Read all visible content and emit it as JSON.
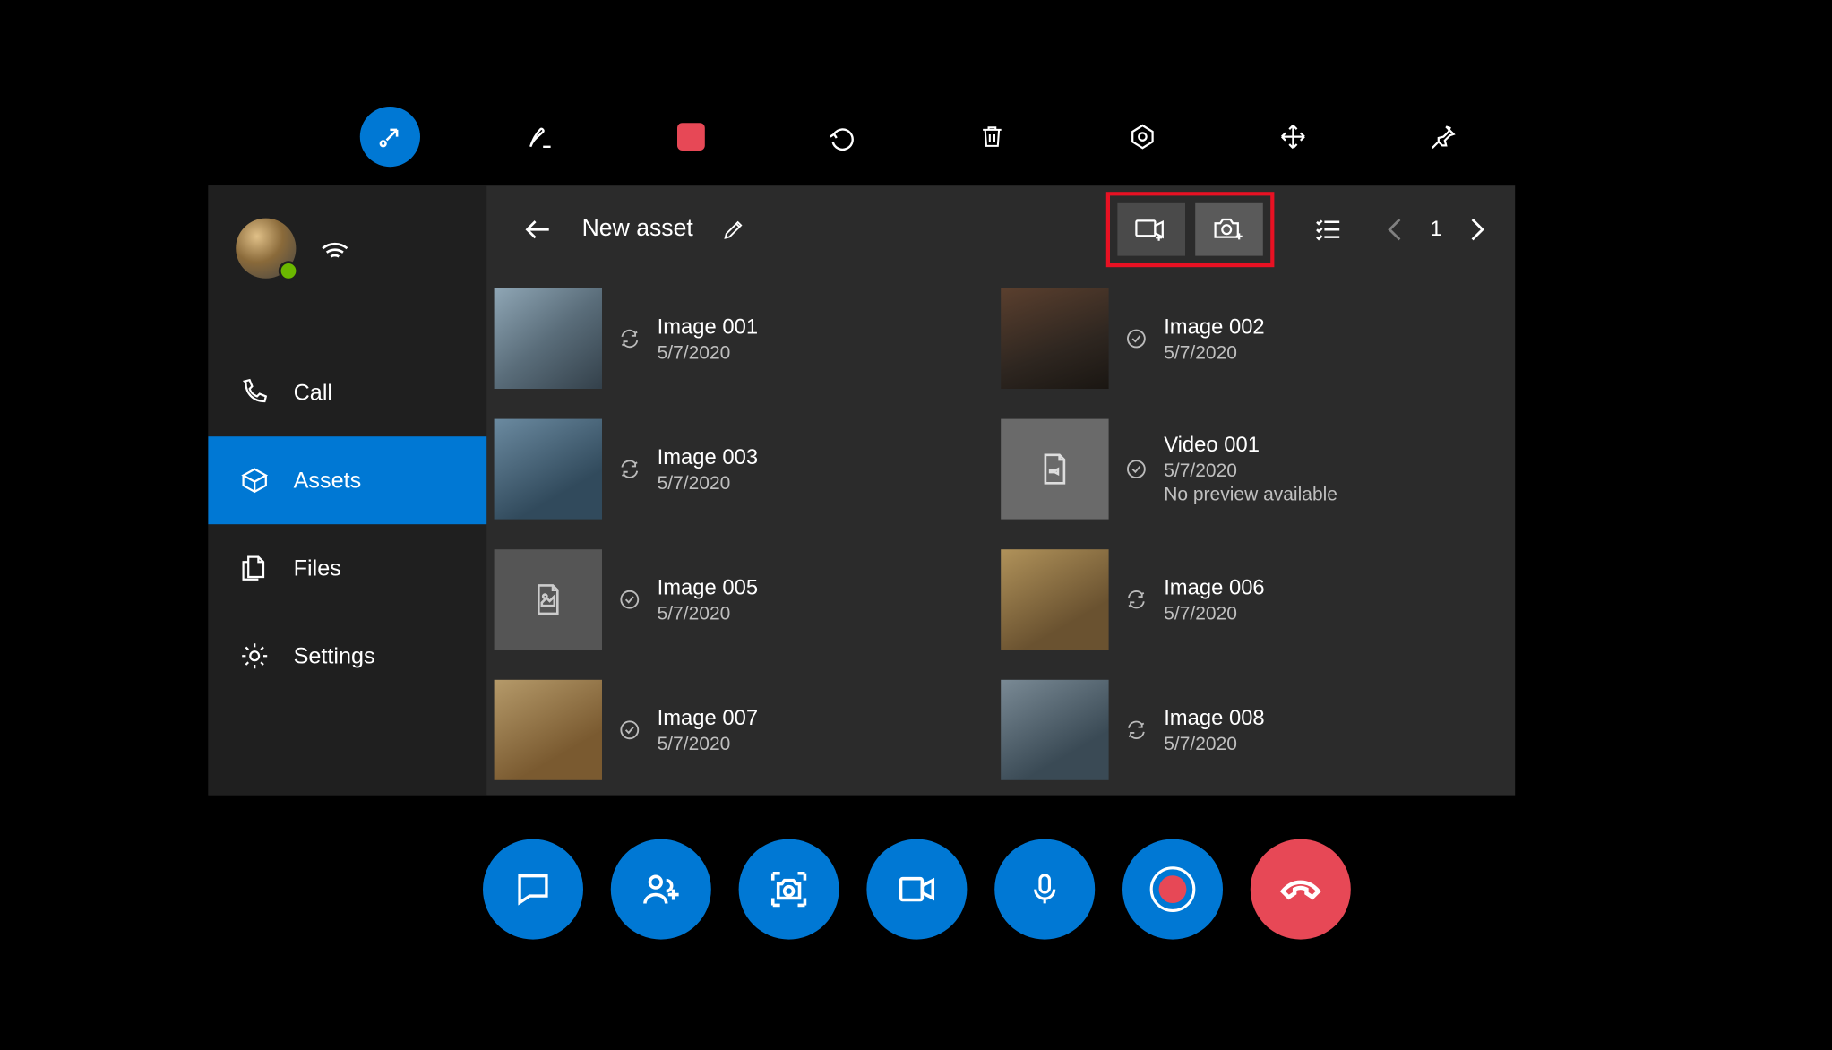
{
  "topToolbar": {
    "items": [
      "arrow-collapse",
      "ink",
      "color",
      "undo",
      "delete",
      "hex",
      "move",
      "pin"
    ]
  },
  "sidebar": {
    "nav": [
      {
        "key": "call",
        "label": "Call"
      },
      {
        "key": "assets",
        "label": "Assets"
      },
      {
        "key": "files",
        "label": "Files"
      },
      {
        "key": "settings",
        "label": "Settings"
      }
    ]
  },
  "header": {
    "title": "New asset",
    "page": "1"
  },
  "assets": [
    {
      "title": "Image 001",
      "date": "5/7/2020",
      "status": "sync",
      "thumb": "img1"
    },
    {
      "title": "Image 002",
      "date": "5/7/2020",
      "status": "ok",
      "thumb": "img2"
    },
    {
      "title": "Image 003",
      "date": "5/7/2020",
      "status": "sync",
      "thumb": "img3"
    },
    {
      "title": "Video 001",
      "date": "5/7/2020",
      "status": "ok",
      "thumb": "ph2",
      "note": "No preview available"
    },
    {
      "title": "Image 005",
      "date": "5/7/2020",
      "status": "ok",
      "thumb": "ph"
    },
    {
      "title": "Image 006",
      "date": "5/7/2020",
      "status": "sync",
      "thumb": "img6"
    },
    {
      "title": "Image 007",
      "date": "5/7/2020",
      "status": "ok",
      "thumb": "img7"
    },
    {
      "title": "Image 008",
      "date": "5/7/2020",
      "status": "sync",
      "thumb": "img8"
    }
  ],
  "callBar": {
    "items": [
      "chat",
      "add-people",
      "capture",
      "video",
      "mic",
      "record",
      "hangup"
    ]
  }
}
